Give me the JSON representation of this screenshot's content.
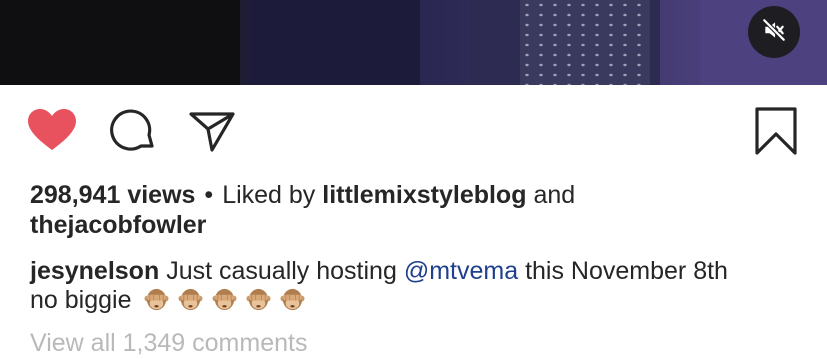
{
  "post": {
    "views": "298,941 views",
    "separator": "•",
    "liked_by_prefix": "Liked by",
    "liked_by_user1": "littlemixstyleblog",
    "liked_by_and": "and",
    "liked_by_user2": "thejacobfowler",
    "caption_user": "jesynelson",
    "caption_text_1": "Just casually hosting",
    "caption_mention": "@mtvema",
    "caption_text_2": "this November 8th",
    "caption_text_3": "no biggie",
    "emojis": [
      "see-no-evil-monkey",
      "see-no-evil-monkey",
      "see-no-evil-monkey",
      "see-no-evil-monkey",
      "see-no-evil-monkey"
    ],
    "view_comments": "View all 1,349 comments"
  },
  "icons": {
    "like": "heart-icon",
    "comment": "comment-icon",
    "share": "paper-plane-icon",
    "save": "bookmark-icon",
    "mute": "speaker-muted-icon"
  },
  "colors": {
    "like_active": "#e8525f",
    "mention": "#1f3f8f",
    "text": "#262626",
    "muted_text": "#b9b9b9"
  }
}
